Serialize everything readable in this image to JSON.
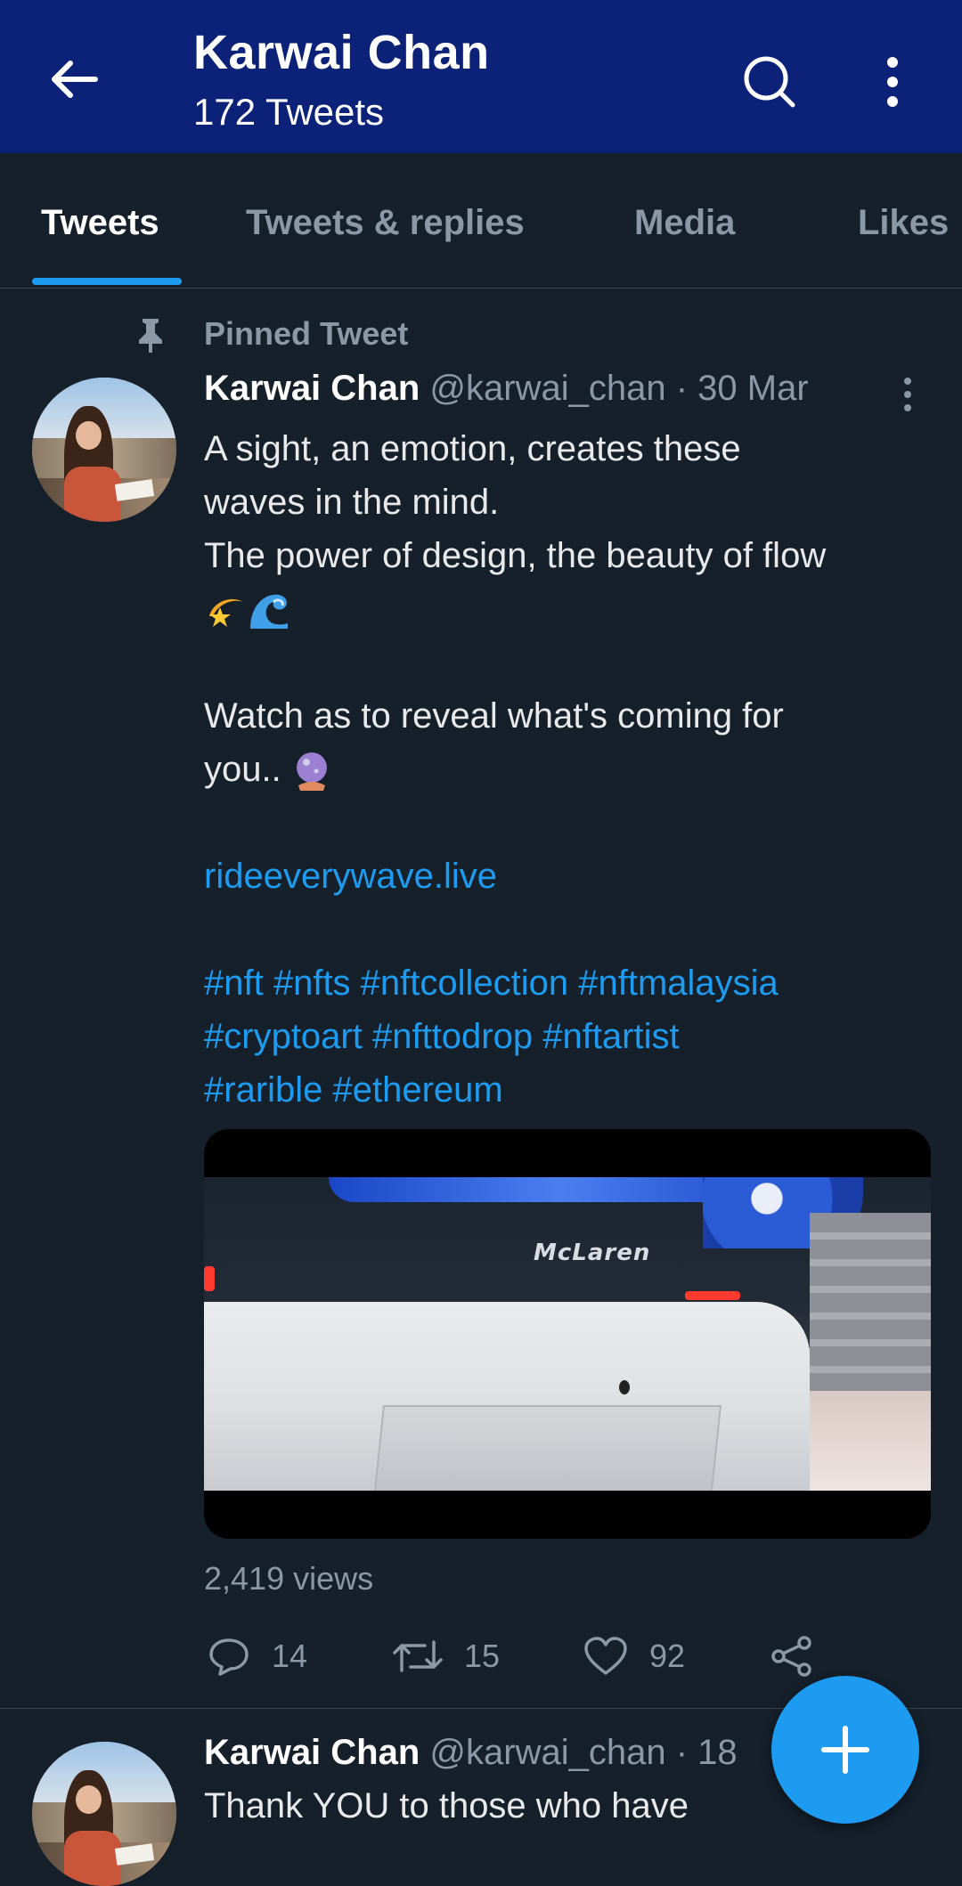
{
  "header": {
    "title": "Karwai Chan",
    "subtitle": "172 Tweets",
    "back_icon": "arrow-left-icon",
    "search_icon": "search-icon",
    "more_icon": "more-vertical-icon",
    "background": "#0b2278"
  },
  "tabs": [
    {
      "label": "Tweets",
      "active": true
    },
    {
      "label": "Tweets & replies",
      "active": false
    },
    {
      "label": "Media",
      "active": false
    },
    {
      "label": "Likes",
      "active": false
    }
  ],
  "pinned_tweet": {
    "pinned_label": "Pinned Tweet",
    "author_name": "Karwai Chan",
    "handle_date": "@karwai_chan · 30 Mar",
    "text_lines": [
      "A sight, an emotion, creates these",
      "waves in the mind.",
      "The power of design, the beauty of flow",
      "Watch as to reveal what's coming for",
      "you.."
    ],
    "link": "rideeverywave.live",
    "hashtag_lines": [
      "#nft #nfts #nftcollection #nftmalaysia",
      "#cryptoart #nfttodrop #nftartist",
      "#rarible #ethereum"
    ],
    "emojis": [
      "dizzy-star-emoji",
      "water-wave-emoji",
      "crystal-ball-emoji"
    ],
    "media_logo_text": "McLaren",
    "views": "2,419 views",
    "actions": {
      "reply_count": "14",
      "retweet_count": "15",
      "like_count": "92"
    }
  },
  "next_tweet": {
    "author_name": "Karwai Chan",
    "handle_date": "@karwai_chan · 18",
    "text": "Thank YOU to those who have"
  },
  "colors": {
    "accent": "#1d9bf0",
    "background": "#15202b",
    "muted_text": "#8b98a5"
  }
}
